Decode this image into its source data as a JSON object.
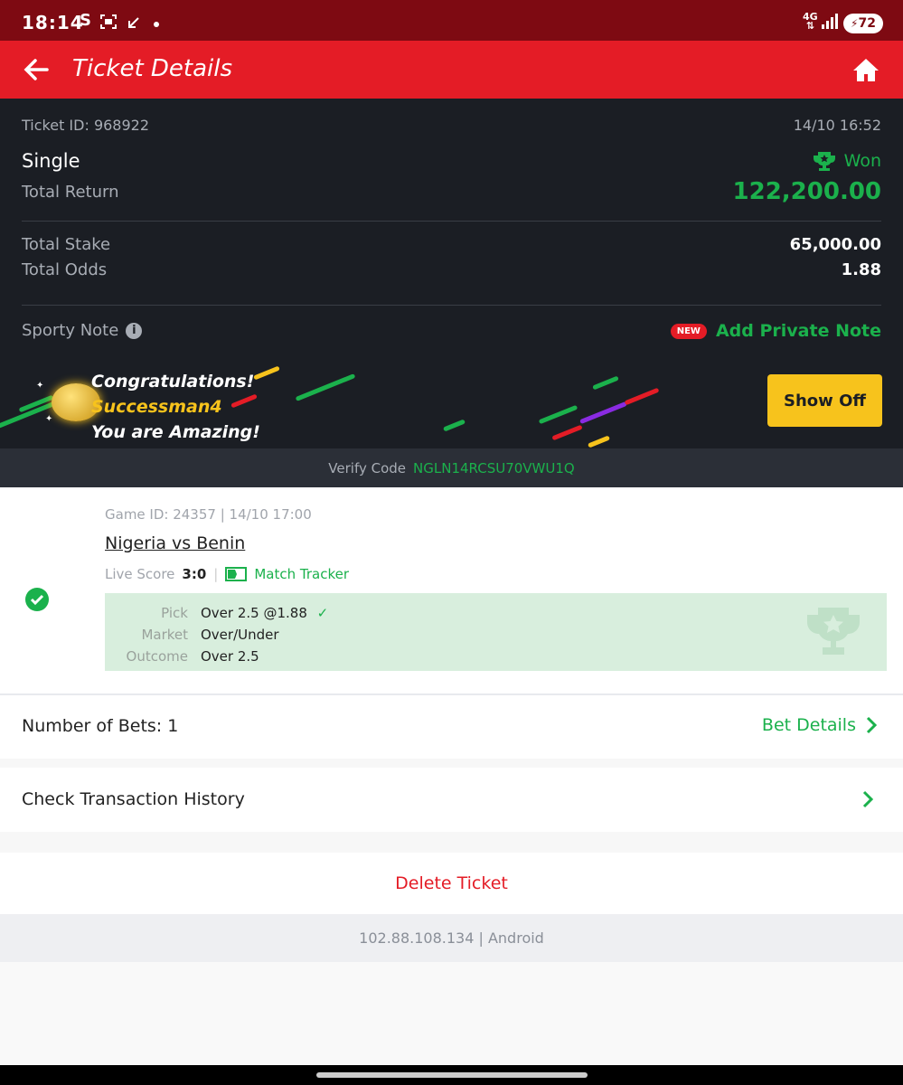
{
  "status_bar": {
    "time": "18:14",
    "left_icons": [
      "s-logo-icon",
      "screenshot-icon",
      "arrow-icon",
      "dot-icon"
    ],
    "network": "4G",
    "battery": "72"
  },
  "app_bar": {
    "title": "Ticket Details"
  },
  "summary": {
    "ticket_id": "Ticket ID: 968922",
    "datetime": "14/10 16:52",
    "bet_type": "Single",
    "status": "Won",
    "total_return_label": "Total Return",
    "total_return_value": "122,200.00",
    "total_stake_label": "Total Stake",
    "total_stake_value": "65,000.00",
    "total_odds_label": "Total Odds",
    "total_odds_value": "1.88",
    "sporty_note_label": "Sporty Note",
    "new_badge": "NEW",
    "add_note_label": "Add Private Note"
  },
  "banner": {
    "line1": "Congratulations!",
    "username": "Successman4",
    "line3": "You are Amazing!",
    "show_off_label": "Show Off"
  },
  "verify": {
    "label": "Verify Code",
    "code": "NGLN14RCSU70VWU1Q"
  },
  "match": {
    "game_line": "Game ID: 24357 | 14/10 17:00",
    "teams": "Nigeria vs Benin",
    "live_score_label": "Live Score",
    "live_score": "3:0",
    "match_tracker_label": "Match Tracker",
    "pick_label": "Pick",
    "pick_value": "Over 2.5 @1.88",
    "market_label": "Market",
    "market_value": "Over/Under",
    "outcome_label": "Outcome",
    "outcome_value": "Over 2.5"
  },
  "bets": {
    "number_label": "Number of Bets: 1",
    "details_label": "Bet Details"
  },
  "history": {
    "label": "Check Transaction History"
  },
  "delete": {
    "label": "Delete Ticket"
  },
  "footer": {
    "device": "102.88.108.134 | Android"
  },
  "colors": {
    "brand_red": "#e41c26",
    "dark_bg": "#1b1e24",
    "win_green": "#1bb14c",
    "gold": "#f7c31c"
  }
}
